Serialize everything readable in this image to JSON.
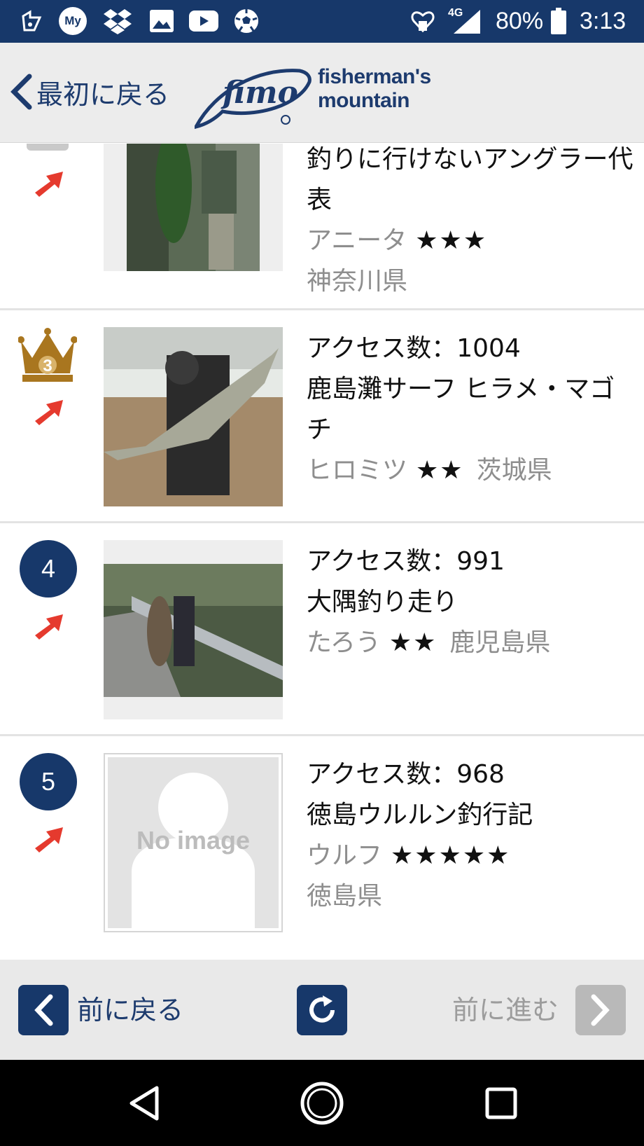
{
  "status_bar": {
    "icons": [
      "store-icon",
      "mydocomo-icon",
      "dropbox-icon",
      "gallery-icon",
      "youtube-icon",
      "soccer-ball-icon",
      "heart-badge-icon",
      "signal-4g-icon",
      "battery-icon"
    ],
    "mydocomo_label": "My",
    "network": "4G",
    "battery": "80%",
    "time": "3:13"
  },
  "header": {
    "back_label": "最初に戻る",
    "logo_script": "fimo",
    "logo_line1": "fisherman's",
    "logo_line2": "mountain"
  },
  "colors": {
    "brand_navy": "#17386a",
    "gray_text": "#8e8e8e",
    "trend_red": "#e53a2e",
    "crown_gold": "#a9761f"
  },
  "rankings": [
    {
      "rank": "",
      "badge": "partial",
      "title": "釣りに行けないアングラー代表",
      "user": "アニータ",
      "stars": "★★★",
      "prefecture": "神奈川県"
    },
    {
      "rank": "3",
      "badge": "crown",
      "access": "アクセス数：1004",
      "title": "鹿島灘サーフ ヒラメ・マゴチ",
      "user": "ヒロミツ",
      "stars": "★★",
      "prefecture": "茨城県"
    },
    {
      "rank": "4",
      "badge": "circle",
      "access": "アクセス数：991",
      "title": "大隅釣り走り",
      "user": "たろう",
      "stars": "★★",
      "prefecture": "鹿児島県"
    },
    {
      "rank": "5",
      "badge": "circle",
      "access": "アクセス数：968",
      "title": "徳島ウルルン釣行記",
      "user": "ウルフ",
      "stars": "★★★★★",
      "prefecture": "徳島県",
      "no_image_label": "No image"
    }
  ],
  "bottom_nav": {
    "prev_label": "前に戻る",
    "next_label": "前に進む"
  }
}
